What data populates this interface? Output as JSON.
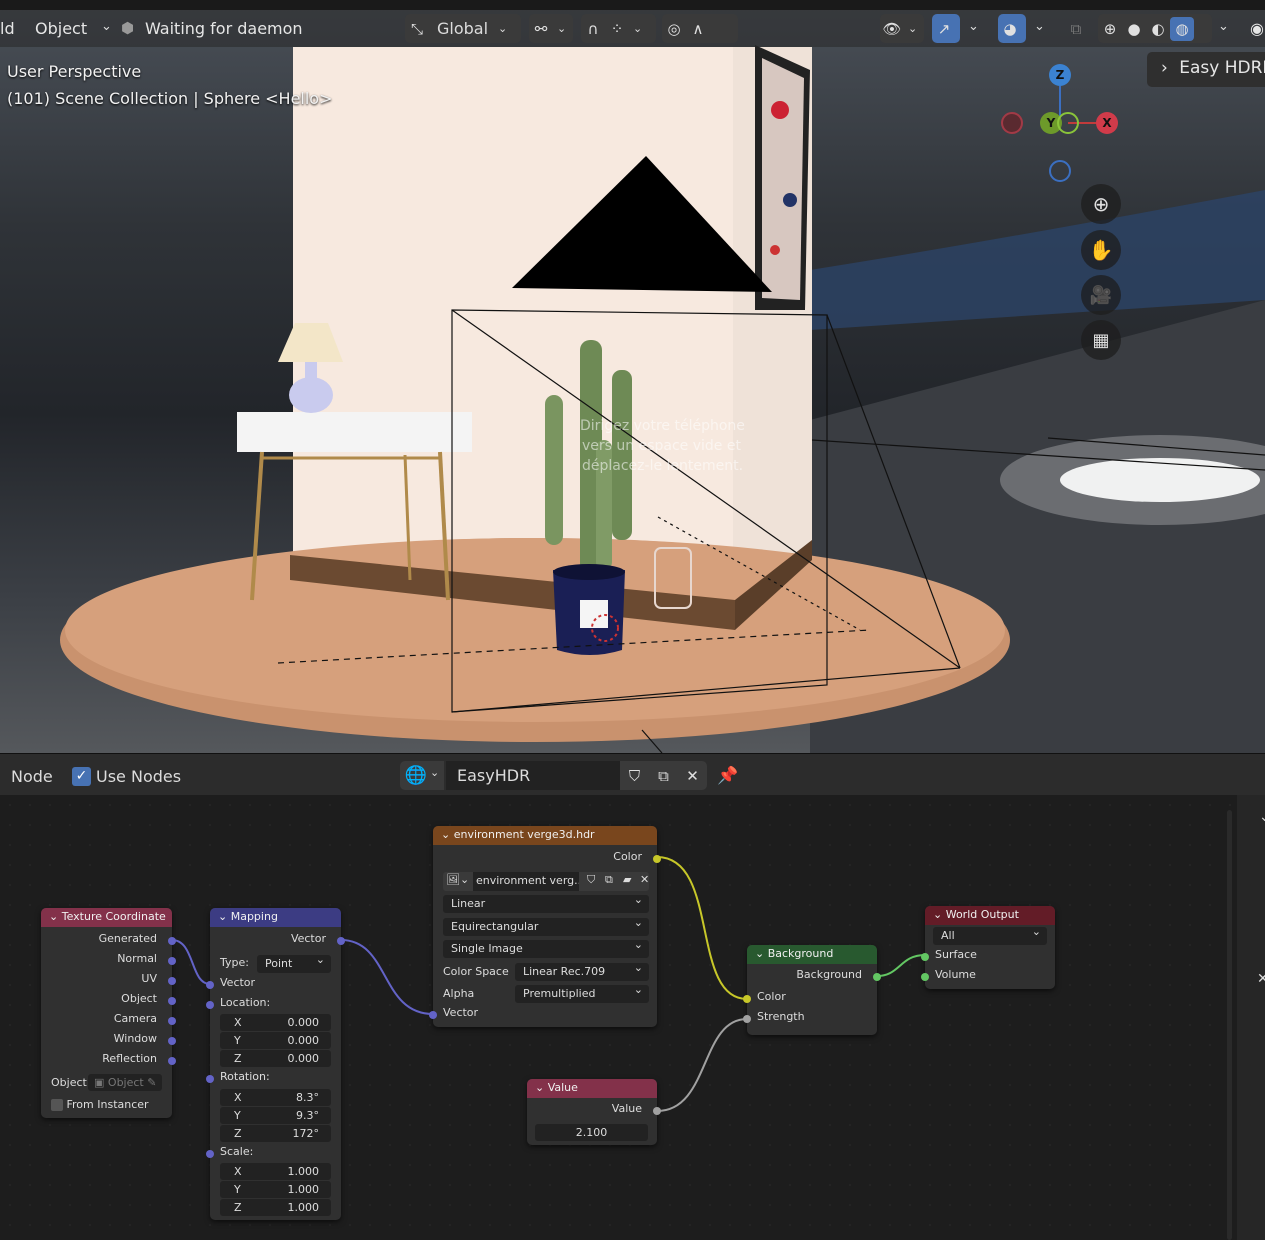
{
  "viewport_header": {
    "editor_left_fragment": "ld",
    "mode_label": "Object",
    "status_text": "Waiting for daemon",
    "transform_orientation": "Global"
  },
  "overlay": {
    "view_name": "User Perspective",
    "collection_info": "(101) Scene Collection | Sphere <Hello>"
  },
  "gizmo": {
    "z": "Z",
    "y": "Y",
    "x": "X"
  },
  "side_tab": {
    "label": "Easy HDRI"
  },
  "scene_text": {
    "line1": "Dirigez votre téléphone",
    "line2": "vers un espace vide et",
    "line3": "déplacez-le lentement."
  },
  "node_header": {
    "menu_node": "Node",
    "use_nodes_label": "Use Nodes",
    "world_name": "EasyHDR"
  },
  "nodes": {
    "texture_coordinate": {
      "title": "Texture Coordinate",
      "outputs": [
        "Generated",
        "Normal",
        "UV",
        "Object",
        "Camera",
        "Window",
        "Reflection"
      ],
      "object_label": "Object:",
      "object_placeholder": "Object",
      "from_instancer": "From Instancer"
    },
    "mapping": {
      "title": "Mapping",
      "output": "Vector",
      "type_label": "Type:",
      "type_value": "Point",
      "vector_input": "Vector",
      "location_label": "Location:",
      "location": [
        {
          "axis": "X",
          "value": "0.000"
        },
        {
          "axis": "Y",
          "value": "0.000"
        },
        {
          "axis": "Z",
          "value": "0.000"
        }
      ],
      "rotation_label": "Rotation:",
      "rotation": [
        {
          "axis": "X",
          "value": "8.3°"
        },
        {
          "axis": "Y",
          "value": "9.3°"
        },
        {
          "axis": "Z",
          "value": "172°"
        }
      ],
      "scale_label": "Scale:",
      "scale": [
        {
          "axis": "X",
          "value": "1.000"
        },
        {
          "axis": "Y",
          "value": "1.000"
        },
        {
          "axis": "Z",
          "value": "1.000"
        }
      ]
    },
    "environment": {
      "title": "environment verge3d.hdr",
      "output": "Color",
      "image_name": "environment verg...",
      "interpolation": "Linear",
      "projection": "Equirectangular",
      "source": "Single Image",
      "color_space_label": "Color Space",
      "color_space_value": "Linear Rec.709",
      "alpha_label": "Alpha",
      "alpha_value": "Premultiplied",
      "vector_input": "Vector"
    },
    "background": {
      "title": "Background",
      "output": "Background",
      "input_color": "Color",
      "input_strength": "Strength"
    },
    "world_output": {
      "title": "World Output",
      "target": "All",
      "surface": "Surface",
      "volume": "Volume"
    },
    "value": {
      "title": "Value",
      "output": "Value",
      "number": "2.100"
    }
  },
  "colors": {
    "header_input": "#83314a",
    "header_vector": "#3c3c83",
    "header_texture": "#79461d",
    "header_shader": "#28592f",
    "header_output": "#631c27",
    "accent_blue": "#4772b3"
  }
}
